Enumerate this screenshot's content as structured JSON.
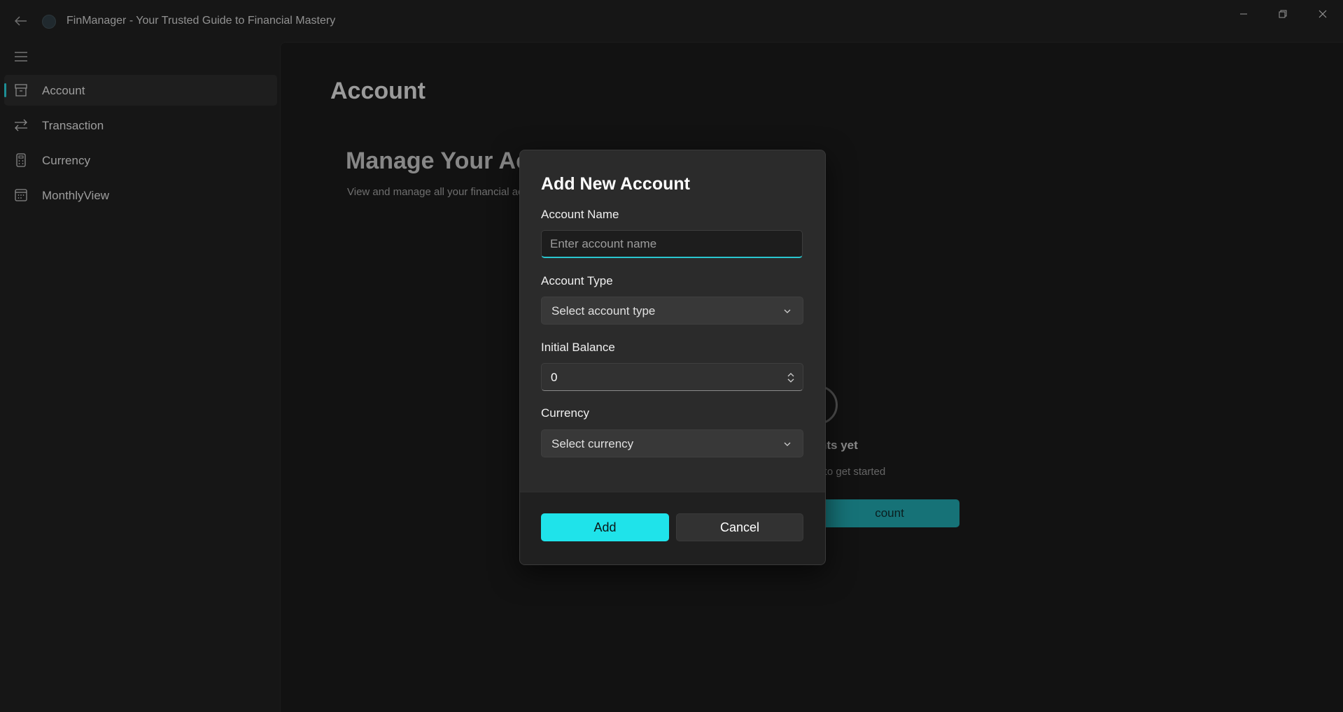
{
  "window": {
    "title": "FinManager - Your Trusted Guide to Financial Mastery"
  },
  "sidebar": {
    "items": [
      {
        "label": "Account",
        "icon": "archive-box-icon",
        "selected": true
      },
      {
        "label": "Transaction",
        "icon": "arrows-swap-icon",
        "selected": false
      },
      {
        "label": "Currency",
        "icon": "calculator-icon",
        "selected": false
      },
      {
        "label": "MonthlyView",
        "icon": "calendar-icon",
        "selected": false
      }
    ]
  },
  "main": {
    "page_title": "Account",
    "heading": "Manage Your Ac",
    "subheading": "View and manage all your financial ac",
    "empty_title": "nts yet",
    "empty_subtitle": "nt to get started",
    "empty_button_label": "count"
  },
  "dialog": {
    "title": "Add New Account",
    "account_name": {
      "label": "Account Name",
      "placeholder": "Enter account name",
      "value": ""
    },
    "account_type": {
      "label": "Account Type",
      "selected": "Select account type"
    },
    "initial_balance": {
      "label": "Initial Balance",
      "value": "0"
    },
    "currency": {
      "label": "Currency",
      "selected": "Select currency"
    },
    "add_label": "Add",
    "cancel_label": "Cancel"
  },
  "colors": {
    "accent": "#29c6cf",
    "primary_button": "#1fe3ea",
    "background": "#1f1f1f",
    "dialog_background": "#2b2b2b"
  }
}
